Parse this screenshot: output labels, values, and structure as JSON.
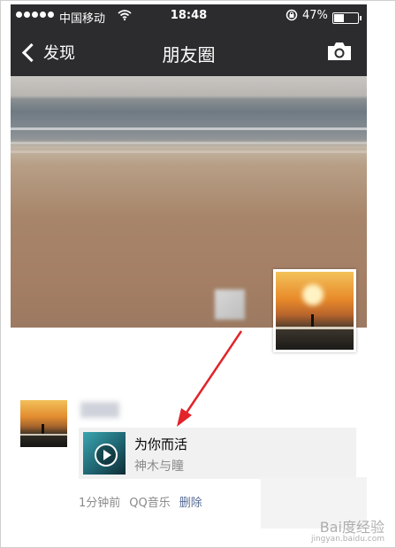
{
  "status_bar": {
    "carrier": "中国移动",
    "time": "18:48",
    "battery_percent": "47%",
    "battery_level": 0.47
  },
  "nav": {
    "back_label": "发现",
    "title": "朋友圈",
    "camera_icon": "camera-icon"
  },
  "post": {
    "music": {
      "title": "为你而活",
      "artist": "神木与瞳"
    },
    "time": "1分钟前",
    "source": "QQ音乐",
    "delete_label": "删除"
  },
  "watermark": {
    "text": "Bai度经验",
    "sub": "jingyan.baidu.com"
  },
  "colors": {
    "nav_bg": "#2c2c2e",
    "link": "#576b95",
    "annotation_arrow": "#e2232a"
  }
}
